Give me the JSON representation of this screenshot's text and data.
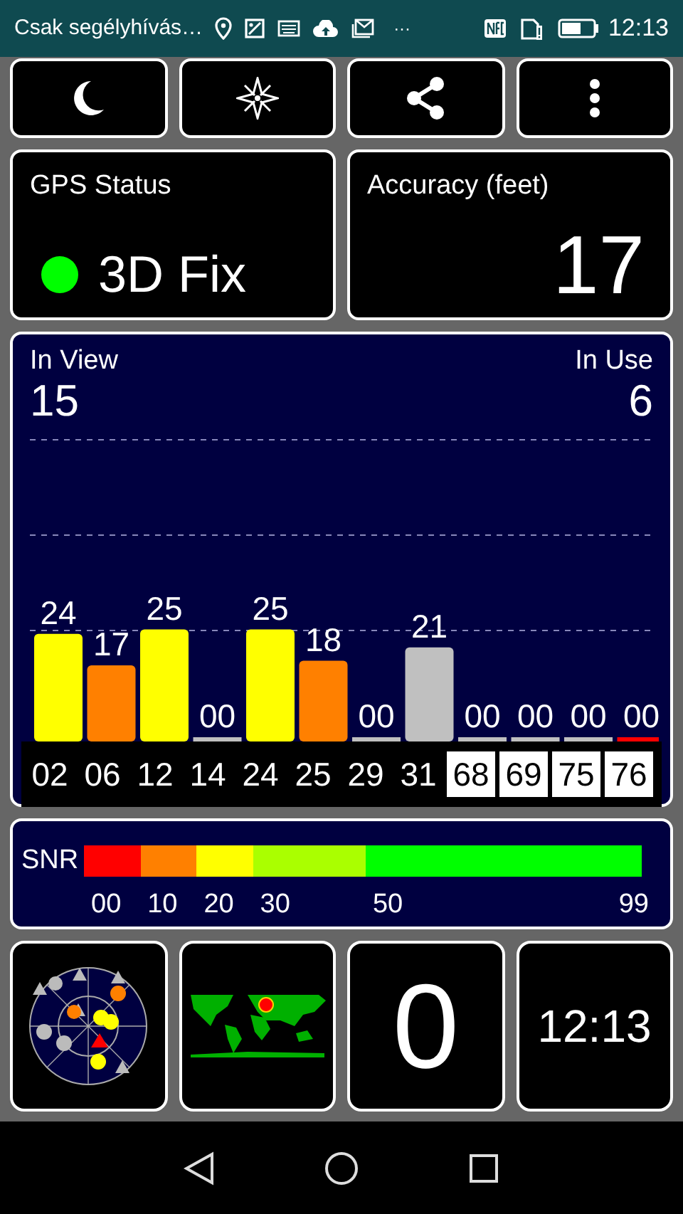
{
  "status_bar": {
    "carrier": "Csak segélyhívás…",
    "more": "···",
    "time": "12:13"
  },
  "toolbar": {
    "buttons": [
      {
        "kind": "moon"
      },
      {
        "kind": "compass"
      },
      {
        "kind": "share"
      },
      {
        "kind": "menu"
      }
    ]
  },
  "gps_status": {
    "title": "GPS Status",
    "value": "3D Fix",
    "color": "#00ff00"
  },
  "accuracy": {
    "title": "Accuracy (feet)",
    "value": "17"
  },
  "satellites_panel": {
    "in_view_label": "In View",
    "in_view": "15",
    "in_use_label": "In Use",
    "in_use": "6",
    "chart_data": {
      "type": "bar",
      "categories": [
        "02",
        "06",
        "12",
        "14",
        "24",
        "25",
        "29",
        "31",
        "68",
        "69",
        "75",
        "76"
      ],
      "values": [
        24,
        17,
        25,
        0,
        25,
        18,
        0,
        21,
        0,
        0,
        0,
        0
      ],
      "data_labels": true,
      "value_labels": [
        "24",
        "17",
        "25",
        "00",
        "25",
        "18",
        "00",
        "21",
        "00",
        "00",
        "00",
        "00"
      ]
    },
    "satellites": [
      {
        "color": "#ffff00",
        "boxed": false
      },
      {
        "color": "#ff8000",
        "boxed": false
      },
      {
        "color": "#ffff00",
        "boxed": false
      },
      {
        "color": "#c0c0c0",
        "boxed": false
      },
      {
        "color": "#ffff00",
        "boxed": false
      },
      {
        "color": "#ff8000",
        "boxed": false
      },
      {
        "color": "#c0c0c0",
        "boxed": false
      },
      {
        "color": "#c0c0c0",
        "boxed": false
      },
      {
        "color": "#c0c0c0",
        "boxed": true
      },
      {
        "color": "#c0c0c0",
        "boxed": true
      },
      {
        "color": "#c0c0c0",
        "boxed": true
      },
      {
        "color": "#ff0000",
        "boxed": true
      }
    ]
  },
  "snr_legend": {
    "label": "SNR",
    "ticks": [
      "00",
      "10",
      "20",
      "30",
      "50",
      "99"
    ],
    "segments": [
      {
        "color": "#ff0000"
      },
      {
        "color": "#ff8000"
      },
      {
        "color": "#ffff00"
      },
      {
        "color": "#aaff00"
      },
      {
        "color": "#00ff00"
      }
    ]
  },
  "tiles": {
    "count": "0",
    "clock": "12:13"
  }
}
